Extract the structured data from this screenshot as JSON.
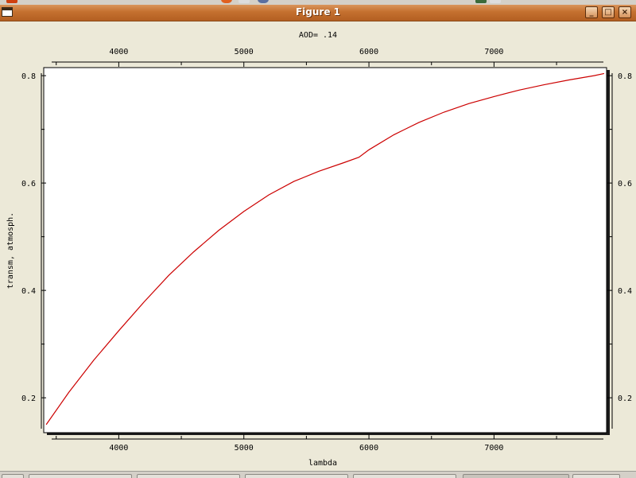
{
  "window": {
    "title": "Figure 1"
  },
  "colors": {
    "titlebar": "#c4702f",
    "line": "#cc0000",
    "plot_bg": "#ffffff",
    "figure_bg": "#ece9d8"
  },
  "chart_data": {
    "type": "line",
    "title": "AOD= .14",
    "xlabel": "lambda",
    "ylabel": "transm, atmosph.",
    "xlim": [
      3400,
      7900
    ],
    "ylim": [
      0.135,
      0.815
    ],
    "x_ticks_major": [
      4000,
      5000,
      6000,
      7000
    ],
    "x_tick_labels": [
      "4000",
      "5000",
      "6000",
      "7000"
    ],
    "y_ticks_major": [
      0.2,
      0.4,
      0.6,
      0.8
    ],
    "y_tick_labels": [
      "0.2",
      "0.4",
      "0.6",
      "0.8"
    ],
    "grid": false,
    "series": [
      {
        "x": [
          3420,
          3600,
          3800,
          4000,
          4200,
          4400,
          4600,
          4800,
          5000,
          5200,
          5400,
          5600,
          5800,
          5920,
          6000,
          6200,
          6400,
          6600,
          6800,
          7000,
          7200,
          7400,
          7600,
          7800,
          7880
        ],
        "y": [
          0.15,
          0.21,
          0.27,
          0.325,
          0.378,
          0.428,
          0.472,
          0.512,
          0.547,
          0.578,
          0.603,
          0.622,
          0.638,
          0.648,
          0.662,
          0.69,
          0.713,
          0.732,
          0.748,
          0.761,
          0.773,
          0.783,
          0.792,
          0.8,
          0.804
        ]
      }
    ]
  }
}
